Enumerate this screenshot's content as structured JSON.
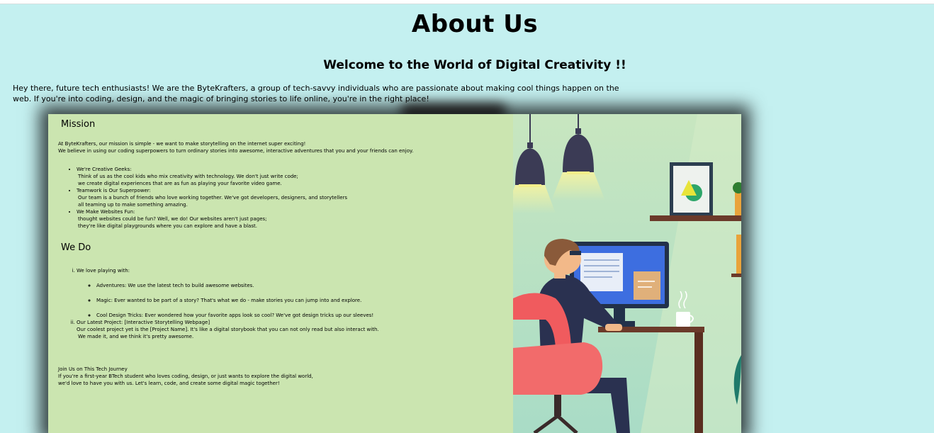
{
  "page": {
    "title": "About Us",
    "subtitle": "Welcome to the World of Digital Creativity !!",
    "intro": "Hey there, future tech enthusiasts! We are the ByteKrafters, a group of tech-savvy individuals who are passionate about making cool things happen on the web.  If you're into coding, design, and the magic of bringing stories to life online, you're in the right place!"
  },
  "mission": {
    "heading": "Mission",
    "line1": "At ByteKrafters, our mission is simple - we want to make storytelling on the internet super exciting!",
    "line2": "We believe in using our coding superpowers to turn ordinary stories into awesome, interactive adventures that you and your friends can enjoy.",
    "items": [
      {
        "title": "We're Creative Geeks:",
        "line1": "Think of us as the cool kids who mix creativity with technology. We don't just write code;",
        "line2": "we create digital experiences that are as fun as playing your favorite video game."
      },
      {
        "title": "Teamwork is Our Superpower:",
        "line1": "Our team is a bunch of friends who love working together. We've got developers, designers, and storytellers",
        "line2": "all teaming up to make something amazing."
      },
      {
        "title": "We Make Websites Fun:",
        "line1": "thought websites could be fun? Well, we do! Our websites aren't just pages;",
        "line2": "they're like digital playgrounds where you can explore and have a blast."
      }
    ]
  },
  "wedo": {
    "heading": "We Do",
    "love_title": "We love playing with:",
    "love_items": [
      "Adventures: We use the latest tech to build awesome websites.",
      "Magic: Ever wanted to be part of a story? That's what we do - make stories you can jump into and explore.",
      "Cool Design Tricks: Ever wondered how your favorite apps look so cool? We've got design tricks up our sleeves!"
    ],
    "project_title": "Our Latest Project: [Interactive Storytelling Webpage]",
    "project_line1": "Our coolest project yet is the [Project Name]. It's like a digital storybook that you can not only read but also interact with.",
    "project_line2": "We made it, and we think it's pretty awesome."
  },
  "join": {
    "title": "Join Us on This Tech Journey",
    "line1": "If you're a first-year BTech student who loves coding, design, or just wants to explore the digital world,",
    "line2": "we'd love to have you with us. Let's learn, code, and create some digital magic together!"
  },
  "colors": {
    "page_background": "#c4f0f0",
    "card_background": "#cbe5b0",
    "illustration_background": "#bfe3cf",
    "chair_red": "#f05b5e",
    "monitor_blue": "#3d6ee0",
    "lamp_dark": "#3b3b55"
  },
  "icons": {
    "illustration": "person-at-computer-illustration",
    "lamps": "pendant-lamp-icon",
    "picture_frame": "framed-picture-icon",
    "cup": "coffee-cup-icon"
  }
}
